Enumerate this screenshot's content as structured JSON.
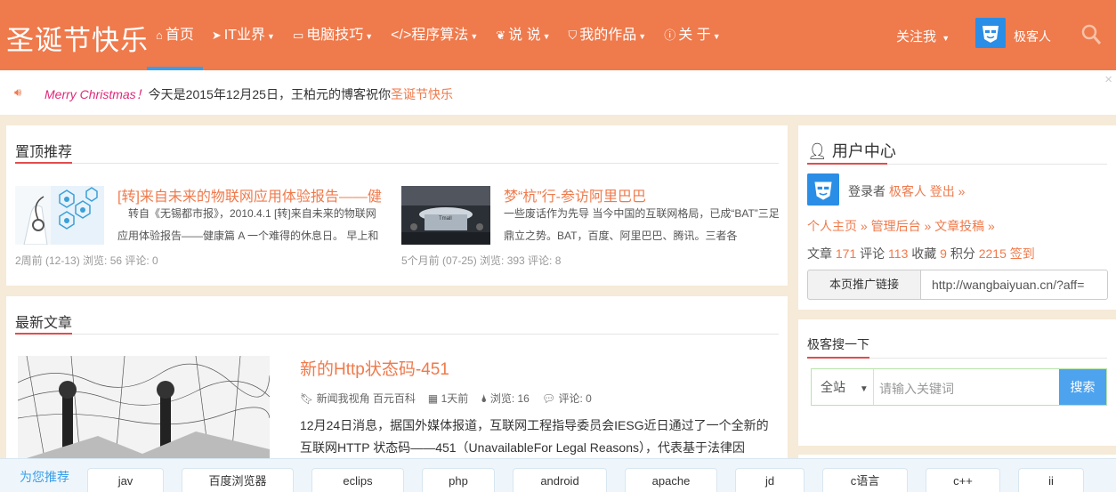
{
  "header": {
    "logo": "圣诞节快乐",
    "nav": [
      {
        "label": "首页",
        "icon": "home-icon"
      },
      {
        "label": "IT业界",
        "icon": "send-icon"
      },
      {
        "label": "电脑技巧",
        "icon": "laptop-icon"
      },
      {
        "label": "</>程序算法"
      },
      {
        "label": "说 说",
        "icon": "leaf-icon"
      },
      {
        "label": "我的作品",
        "icon": "shield-icon"
      },
      {
        "label": "关 于",
        "icon": "info-icon"
      }
    ],
    "follow": "关注我",
    "user": "极客人"
  },
  "notice": {
    "greeting": "Merry Christmas！",
    "text": "今天是2015年12月25日，王柏元的博客祝你",
    "highlight": "圣诞节快乐",
    "close": "×"
  },
  "featured": {
    "title": "置顶推荐",
    "posts": [
      {
        "title": "[转]来自未来的物联网应用体验报告——健",
        "desc": "转自《无锡都市报》，2010.4.1 [转]来自未来的物联网应用体验报告——健康篇 A 一个难得的休息日。 早上和",
        "meta": "2周前 (12-13)  浏览: 56  评论: 0"
      },
      {
        "title": "梦“杭”行-参访阿里巴巴",
        "desc": "一些废话作为先导 当今中国的互联网格局，已成“BAT”三足鼎立之势。BAT，百度、阿里巴巴、腾讯。三者各",
        "meta": "5个月前 (07-25)  浏览: 393  评论: 8"
      }
    ]
  },
  "latest": {
    "title": "最新文章",
    "post": {
      "title": "新的Http状态码-451",
      "category": "新闻我视角 百元百科",
      "time": "1天前",
      "views": "浏览: 16",
      "comments": "评论: 0",
      "body": "12月24日消息，据国外媒体报道，互联网工程指导委员会IESG近日通过了一个全新的互联网HTTP 状态码——451（UnavailableFor Legal Reasons），代表基于法律因"
    }
  },
  "user_center": {
    "title": "用户中心",
    "logged_in_label": "登录者",
    "username": "极客人",
    "logout": "登出 »",
    "links": [
      "个人主页 »",
      "管理后台 »",
      "文章投稿 »"
    ],
    "stats": {
      "articles_label": "文章",
      "articles": "171",
      "comments_label": "评论",
      "comments": "113",
      "favs_label": "收藏",
      "favs": "9",
      "points_label": "积分",
      "points": "2215",
      "signin": "签到"
    },
    "promo_button": "本页推广链接",
    "promo_url": "http://wangbaiyuan.cn/?aff="
  },
  "search": {
    "title": "极客搜一下",
    "scope": "全站",
    "placeholder": "请输入关键词",
    "button": "搜索"
  },
  "recommend": {
    "label": "为您推荐",
    "tags": [
      "jav",
      "百度浏览器",
      "eclips",
      "php",
      "android",
      "apache",
      "jd",
      "c语言",
      "c++",
      "ii"
    ]
  },
  "colors": {
    "accent": "#ef7a4c",
    "link_blue": "#3a9ee8",
    "underline_red": "#e14d4d"
  }
}
